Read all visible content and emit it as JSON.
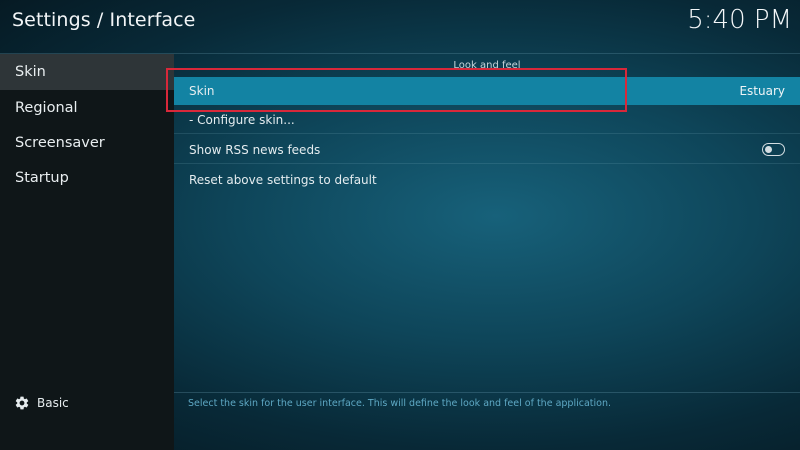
{
  "header": {
    "title": "Settings / Interface",
    "clock": "5:40 PM"
  },
  "sidebar": {
    "items": [
      {
        "label": "Skin",
        "active": true
      },
      {
        "label": "Regional",
        "active": false
      },
      {
        "label": "Screensaver",
        "active": false
      },
      {
        "label": "Startup",
        "active": false
      }
    ],
    "level": {
      "icon": "gear-icon",
      "label": "Basic"
    }
  },
  "main": {
    "section_title": "Look and feel",
    "settings": [
      {
        "label": "Skin",
        "value": "Estuary",
        "focused": true
      },
      {
        "label": "- Configure skin...",
        "value": ""
      },
      {
        "label": "Show RSS news feeds",
        "toggle": false
      },
      {
        "label": "Reset above settings to default"
      }
    ],
    "description": "Select the skin for the user interface. This will define the look and feel of the application."
  },
  "colors": {
    "focus_highlight": "#1383a3",
    "sidebar_active": "#2e3538",
    "annotation_box": "#d8283a"
  }
}
